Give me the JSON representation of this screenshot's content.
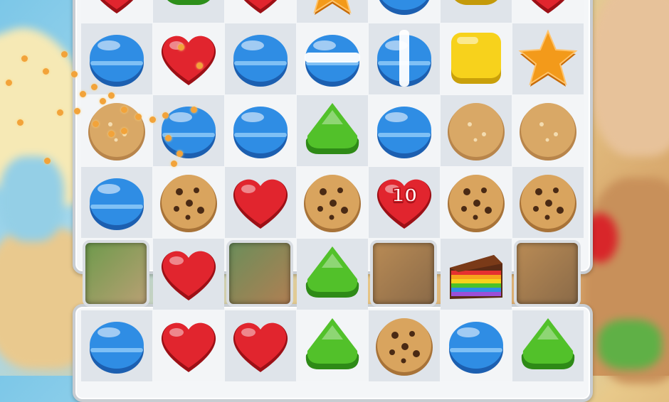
{
  "colors": {
    "blue": "#2f8de4",
    "red": "#e1252e",
    "green": "#52c12a",
    "yellow": "#f7d21c",
    "orange": "#f39a1a",
    "cookie": "#d9a866",
    "board_light": "#f3f5f7",
    "board_dark": "#dfe4ea"
  },
  "board": {
    "columns": 7,
    "rows": [
      {
        "label": "row-0",
        "pieces": [
          "heart-red",
          "macaron-green",
          "heart-red",
          "star-orange",
          "macaron-blue",
          "macaron-yellow",
          "heart-red"
        ]
      },
      {
        "label": "row-1",
        "pieces": [
          "macaron-blue",
          "heart-red",
          "macaron-blue",
          "macaron-blue-striped-h",
          "macaron-blue-striped-v",
          "gumdrop-yellow",
          "star-orange"
        ]
      },
      {
        "label": "row-2",
        "pieces": [
          "sugar-cookie",
          "macaron-blue",
          "macaron-blue",
          "gumdrop-green",
          "macaron-blue",
          "sugar-cookie",
          "sugar-cookie"
        ]
      },
      {
        "label": "row-3",
        "pieces": [
          "macaron-blue",
          "choc-chip-cookie",
          "heart-red",
          "choc-chip-cookie",
          "heart-red-10",
          "choc-chip-cookie",
          "choc-chip-cookie"
        ]
      },
      {
        "label": "row-4",
        "pieces": [
          "hole",
          "heart-red",
          "hole",
          "gumdrop-green",
          "hole",
          "rainbow-cake",
          "hole"
        ]
      },
      {
        "label": "row-5",
        "pieces": [
          "macaron-blue",
          "heart-red",
          "heart-red",
          "gumdrop-green",
          "choc-chip-cookie",
          "macaron-blue",
          "gumdrop-green"
        ]
      }
    ]
  },
  "special": {
    "heart_count_label": "10"
  }
}
